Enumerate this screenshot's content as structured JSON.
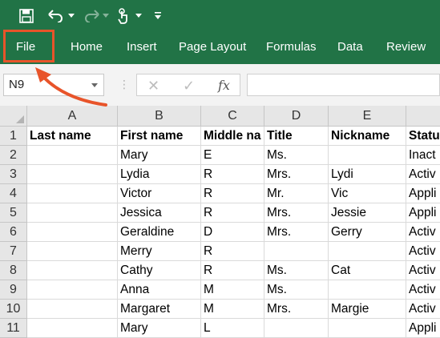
{
  "ribbon": {
    "tabs": [
      "File",
      "Home",
      "Insert",
      "Page Layout",
      "Formulas",
      "Data",
      "Review"
    ]
  },
  "formula_bar": {
    "name_box": "N9",
    "fx_label": "fx",
    "cancel_glyph": "✕",
    "enter_glyph": "✓",
    "separator": "⋮"
  },
  "sheet": {
    "columns": [
      "A",
      "B",
      "C",
      "D",
      "E",
      ""
    ],
    "row_numbers": [
      "1",
      "2",
      "3",
      "4",
      "5",
      "6",
      "7",
      "8",
      "9",
      "10",
      "11"
    ],
    "rows": [
      [
        "Last name",
        "First name",
        "Middle na",
        "Title",
        "Nickname",
        "Statu"
      ],
      [
        "",
        "Mary",
        "E",
        "Ms.",
        "",
        "Inact"
      ],
      [
        "",
        "Lydia",
        "R",
        "Mrs.",
        "Lydi",
        "Activ"
      ],
      [
        "",
        "Victor",
        "R",
        "Mr.",
        "Vic",
        "Appli"
      ],
      [
        "",
        "Jessica",
        "R",
        "Mrs.",
        "Jessie",
        "Appli"
      ],
      [
        "",
        "Geraldine",
        "D",
        "Mrs.",
        "Gerry",
        "Activ"
      ],
      [
        "",
        "Merry",
        "R",
        "",
        "",
        "Activ"
      ],
      [
        "",
        "Cathy",
        "R",
        "Ms.",
        "Cat",
        "Activ"
      ],
      [
        "",
        "Anna",
        "M",
        "Ms.",
        "",
        "Activ"
      ],
      [
        "",
        "Margaret",
        "M",
        "Mrs.",
        "Margie",
        "Activ"
      ],
      [
        "",
        "Mary",
        "L",
        "",
        "",
        "Appli"
      ]
    ]
  },
  "colors": {
    "ribbon": "#217346",
    "highlight": "#e8542a"
  },
  "icons": [
    "save-icon",
    "undo-icon",
    "redo-icon",
    "touch-mode-icon",
    "customize-qat-icon",
    "cancel-icon",
    "enter-icon",
    "function-icon"
  ]
}
